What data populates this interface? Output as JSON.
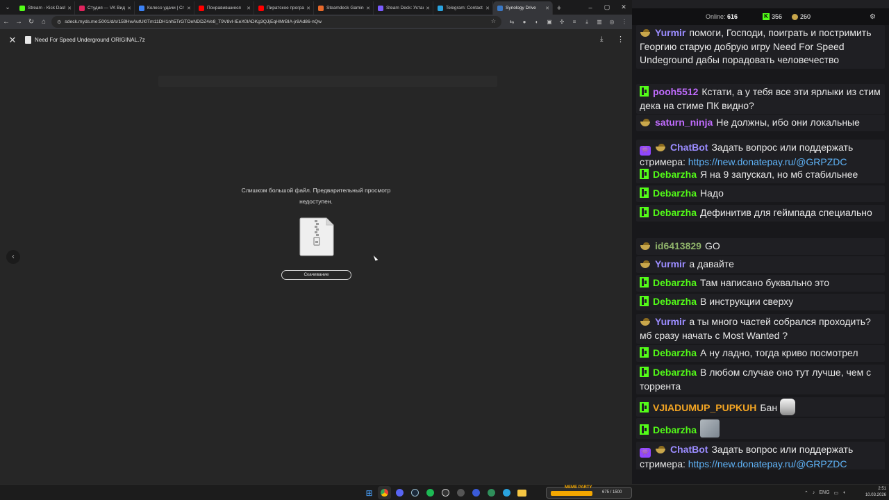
{
  "browser": {
    "tabs": [
      {
        "title": "Stream - Kick Dashb",
        "color": "#53fc18"
      },
      {
        "title": "Студия — VK Видео",
        "color": "#e0245e"
      },
      {
        "title": "Колесо удачи | Cr",
        "color": "#3b82f6"
      },
      {
        "title": "Понравившиеся",
        "color": "#ff0000"
      },
      {
        "title": "Пиратское програ",
        "color": "#ff0000"
      },
      {
        "title": "Steamdeck Gaming",
        "color": "#e8692b"
      },
      {
        "title": "Steam Deck: Устан",
        "color": "#7b5cff"
      },
      {
        "title": "Telegram: Contact",
        "color": "#2aa3df"
      },
      {
        "title": "Synology Drive",
        "color": "#3a78c4",
        "active": true
      }
    ],
    "url": "sdeck.myds.me:5001/d/s/159HwAutUl0Tm11DH1nh5TrGTOeNDDZ4/e8_T9V8vl-lEeX0lADKg3QJjEqHMrBIA-jr8Ad86-nQw"
  },
  "viewer": {
    "file_name": "Need For Speed Underground ORIGINAL.7z",
    "message_line1": "Слишком большой файл. Предварительный просмотр",
    "message_line2": "недоступен.",
    "download_label": "Скачивание"
  },
  "chat": {
    "online_label": "Online:",
    "online_count": "616",
    "kick_count": "356",
    "vk_count": "260",
    "messages": [
      {
        "platform": "vk",
        "nick": "Yurmir",
        "nick_color": "#9b8cff",
        "text": "помоги, Господи, поиграть и постримить Георгию старую добрую игру Need For Speed Undeground дабы порадовать человечество"
      },
      {
        "platform": "kick",
        "nick": "pooh5512",
        "nick_color": "#c16cff",
        "text": "Кстати, а у тебя все эти ярлыки из стим дека на стиме ПК видно?"
      },
      {
        "platform": "vk",
        "nick": "saturn_ninja",
        "nick_color": "#c16cff",
        "text": "Не должны, ибо они локальные"
      },
      {
        "platform": "bot",
        "nick": "ChatBot",
        "nick_color": "#9b8cff",
        "text": "Задать вопрос или поддержать стримера:",
        "link": "https://new.donatepay.ru/@GRPZDC"
      },
      {
        "platform": "kick",
        "nick": "Debarzha",
        "nick_color": "#53fc18",
        "text": "Я на 9 запускал, но мб стабильнее"
      },
      {
        "platform": "kick",
        "nick": "Debarzha",
        "nick_color": "#53fc18",
        "text": "Надо"
      },
      {
        "platform": "kick",
        "nick": "Debarzha",
        "nick_color": "#53fc18",
        "text": "Дефинитив для геймпада специально"
      },
      {
        "platform": "vk",
        "nick": "id6413829",
        "nick_color": "#8fb36a",
        "text": "GO"
      },
      {
        "platform": "vk",
        "nick": "Yurmir",
        "nick_color": "#9b8cff",
        "text": "а давайте"
      },
      {
        "platform": "kick",
        "nick": "Debarzha",
        "nick_color": "#53fc18",
        "text": "Там написано буквально это"
      },
      {
        "platform": "kick",
        "nick": "Debarzha",
        "nick_color": "#53fc18",
        "text": "В инструкции сверху"
      },
      {
        "platform": "vk",
        "nick": "Yurmir",
        "nick_color": "#9b8cff",
        "text": "а ты много частей собрался проходить? мб сразу начать с Most Wanted ?"
      },
      {
        "platform": "kick",
        "nick": "Debarzha",
        "nick_color": "#53fc18",
        "text": "А ну ладно, тогда криво посмотрел"
      },
      {
        "platform": "kick",
        "nick": "Debarzha",
        "nick_color": "#53fc18",
        "text": "В любом случае оно тут лучше, чем с торрента"
      },
      {
        "platform": "kick",
        "nick": "VJIADUMUP_PUPKUH",
        "nick_color": "#f5a623",
        "text": "Бан",
        "emote": "cat"
      },
      {
        "platform": "kick",
        "nick": "Debarzha",
        "nick_color": "#53fc18",
        "text": "",
        "emote": "jerma"
      },
      {
        "platform": "bot",
        "nick": "ChatBot",
        "nick_color": "#9b8cff",
        "text": "Задать вопрос или поддержать стримера:",
        "link": "https://new.donatepay.ru/@GRPZDC"
      }
    ]
  },
  "taskbar": {
    "meme_label": "MEME PARTY",
    "meme_counter": "675 / 1500",
    "lang": "ENG",
    "time": "2:51",
    "date": "10.03.2026"
  }
}
